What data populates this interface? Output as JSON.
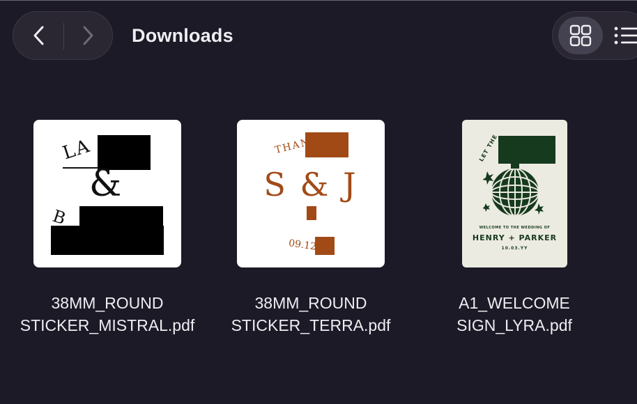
{
  "window": {
    "title": "Downloads"
  },
  "toolbar": {
    "back_icon": "chevron-left-icon",
    "forward_icon": "chevron-right-icon",
    "grid_view_icon": "grid-icon",
    "list_view_icon": "list-icon",
    "active_view": "grid"
  },
  "files": [
    {
      "line1": "38MM_ROUND",
      "line2": "STICKER_MISTRAL.pdf",
      "thumb": {
        "text_top": "LA",
        "amp": "&",
        "text_bottom": "B"
      }
    },
    {
      "line1": "38MM_ROUND",
      "line2": "STICKER_TERRA.pdf",
      "thumb": {
        "text_top": "THAN",
        "initials": "S & J",
        "date": "09.12",
        "accent": "#a24a16"
      }
    },
    {
      "line1": "A1_WELCOME",
      "line2": "SIGN_LYRA.pdf",
      "thumb": {
        "arc_text": "LET THE",
        "subtitle": "WELCOME TO THE WEDDING OF",
        "names": "HENRY + PARKER",
        "date": "10.03.YY",
        "accent": "#163a1d",
        "background": "#ecebe1"
      }
    }
  ]
}
